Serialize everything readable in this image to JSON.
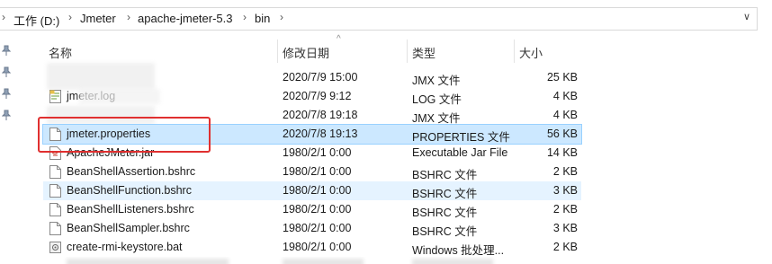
{
  "address_bar": {
    "breadcrumbs": [
      "工作 (D:)",
      "Jmeter",
      "apache-jmeter-5.3",
      "bin"
    ]
  },
  "columns": {
    "name": "名称",
    "date": "修改日期",
    "type": "类型",
    "size": "大小"
  },
  "files": [
    {
      "name": "",
      "date": "2020/7/9 15:00",
      "type": "JMX 文件",
      "size": "25 KB"
    },
    {
      "name": "jmeter.log",
      "date": "2020/7/9 9:12",
      "type": "LOG 文件",
      "size": "4 KB"
    },
    {
      "name": "",
      "date": "2020/7/8 19:18",
      "type": "JMX 文件",
      "size": "4 KB"
    },
    {
      "name": "jmeter.properties",
      "date": "2020/7/8 19:13",
      "type": "PROPERTIES 文件",
      "size": "56 KB"
    },
    {
      "name": "ApacheJMeter.jar",
      "date": "1980/2/1 0:00",
      "type": "Executable Jar File",
      "size": "14 KB"
    },
    {
      "name": "BeanShellAssertion.bshrc",
      "date": "1980/2/1 0:00",
      "type": "BSHRC 文件",
      "size": "2 KB"
    },
    {
      "name": "BeanShellFunction.bshrc",
      "date": "1980/2/1 0:00",
      "type": "BSHRC 文件",
      "size": "3 KB"
    },
    {
      "name": "BeanShellListeners.bshrc",
      "date": "1980/2/1 0:00",
      "type": "BSHRC 文件",
      "size": "2 KB"
    },
    {
      "name": "BeanShellSampler.bshrc",
      "date": "1980/2/1 0:00",
      "type": "BSHRC 文件",
      "size": "3 KB"
    },
    {
      "name": "create-rmi-keystore.bat",
      "date": "1980/2/1 0:00",
      "type": "Windows 批处理...",
      "size": "2 KB"
    }
  ]
}
